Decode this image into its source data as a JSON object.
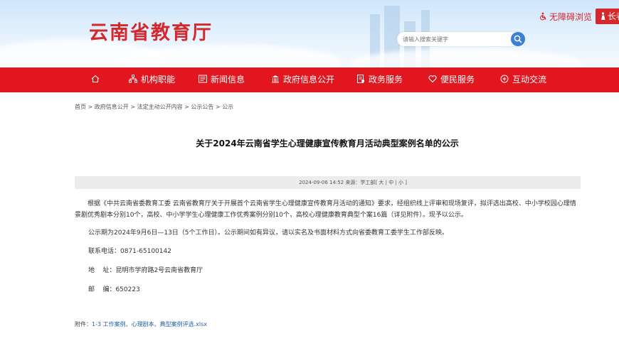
{
  "header": {
    "site_title": "云南省教育厅",
    "search_placeholder": "请输入搜索关键字",
    "accessibility_label": "无障碍浏览",
    "elder_mode_label": "长者"
  },
  "nav": {
    "home_icon": "home-icon",
    "items": [
      {
        "label": "机构职能",
        "icon": "org-icon"
      },
      {
        "label": "新闻信息",
        "icon": "news-icon"
      },
      {
        "label": "政府信息公开",
        "icon": "gov-icon"
      },
      {
        "label": "政务服务",
        "icon": "service-icon"
      },
      {
        "label": "便民服务",
        "icon": "heart-icon"
      },
      {
        "label": "互动交流",
        "icon": "plus-circle-icon"
      }
    ]
  },
  "breadcrumb": [
    "首页",
    "政府信息公开",
    "法定主动公开内容",
    "公示公告",
    "公示"
  ],
  "article": {
    "title": "关于2024年云南省学生心理健康宣传教育月活动典型案例名单的公示",
    "meta_date": "2024-09-06 14:52",
    "meta_source": "来源：学工部",
    "font_size_labels": [
      "大",
      "中",
      "小"
    ],
    "paragraph1": "根据《中共云南省委教育工委 云南省教育厅关于开展首个云南省学生心理健康宣传教育月活动的通知》要求，经组织线上评审和现场复评，拟评选出高校、中小学校园心理情景剧优秀剧本分别10个，高校、中小学学生心理健康工作优秀案例分别10个，高校心理健康教育典型个案16篇（详见附件）。现予以公示。",
    "paragraph2": "公示期为2024年9月6日—13日（5个工作日）。公示期间如有异议，请以实名及书面材料方式向省委教育工委学生工作部反映。",
    "phone_line": "联系电话：0871-65100142",
    "address_line": "地    址：昆明市学府路2号云南省教育厅",
    "postcode_line": "邮    编：650223",
    "attachment_label": "附件：",
    "attachment_link": "1-3 工作案例、心理剧本、典型案例评选.xlsx"
  },
  "colors": {
    "brand_red": "#e1161e",
    "title_red": "#d4282d",
    "search_blue": "#3b7fd4",
    "link_blue": "#2660a8"
  }
}
